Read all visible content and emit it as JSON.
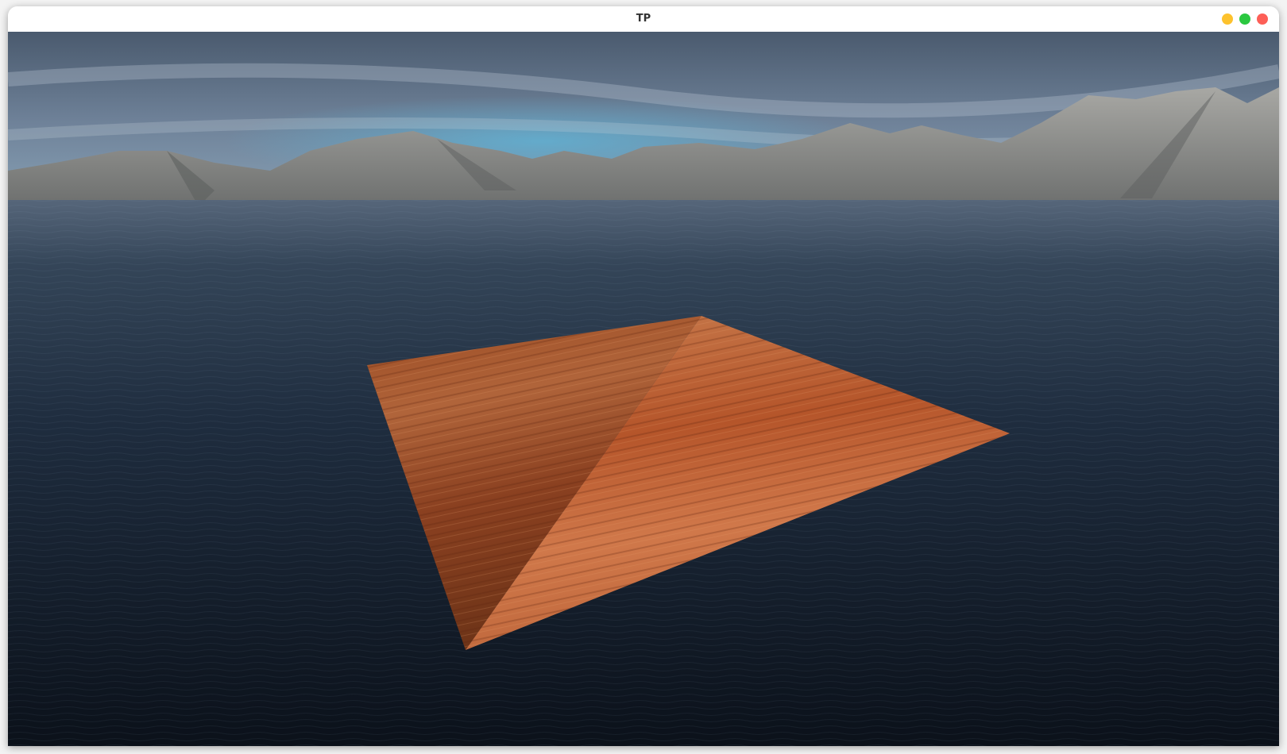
{
  "window": {
    "title": "TP"
  },
  "colors": {
    "minimize": "#fdc22d",
    "maximize": "#2bc840",
    "close": "#fd5f57"
  }
}
